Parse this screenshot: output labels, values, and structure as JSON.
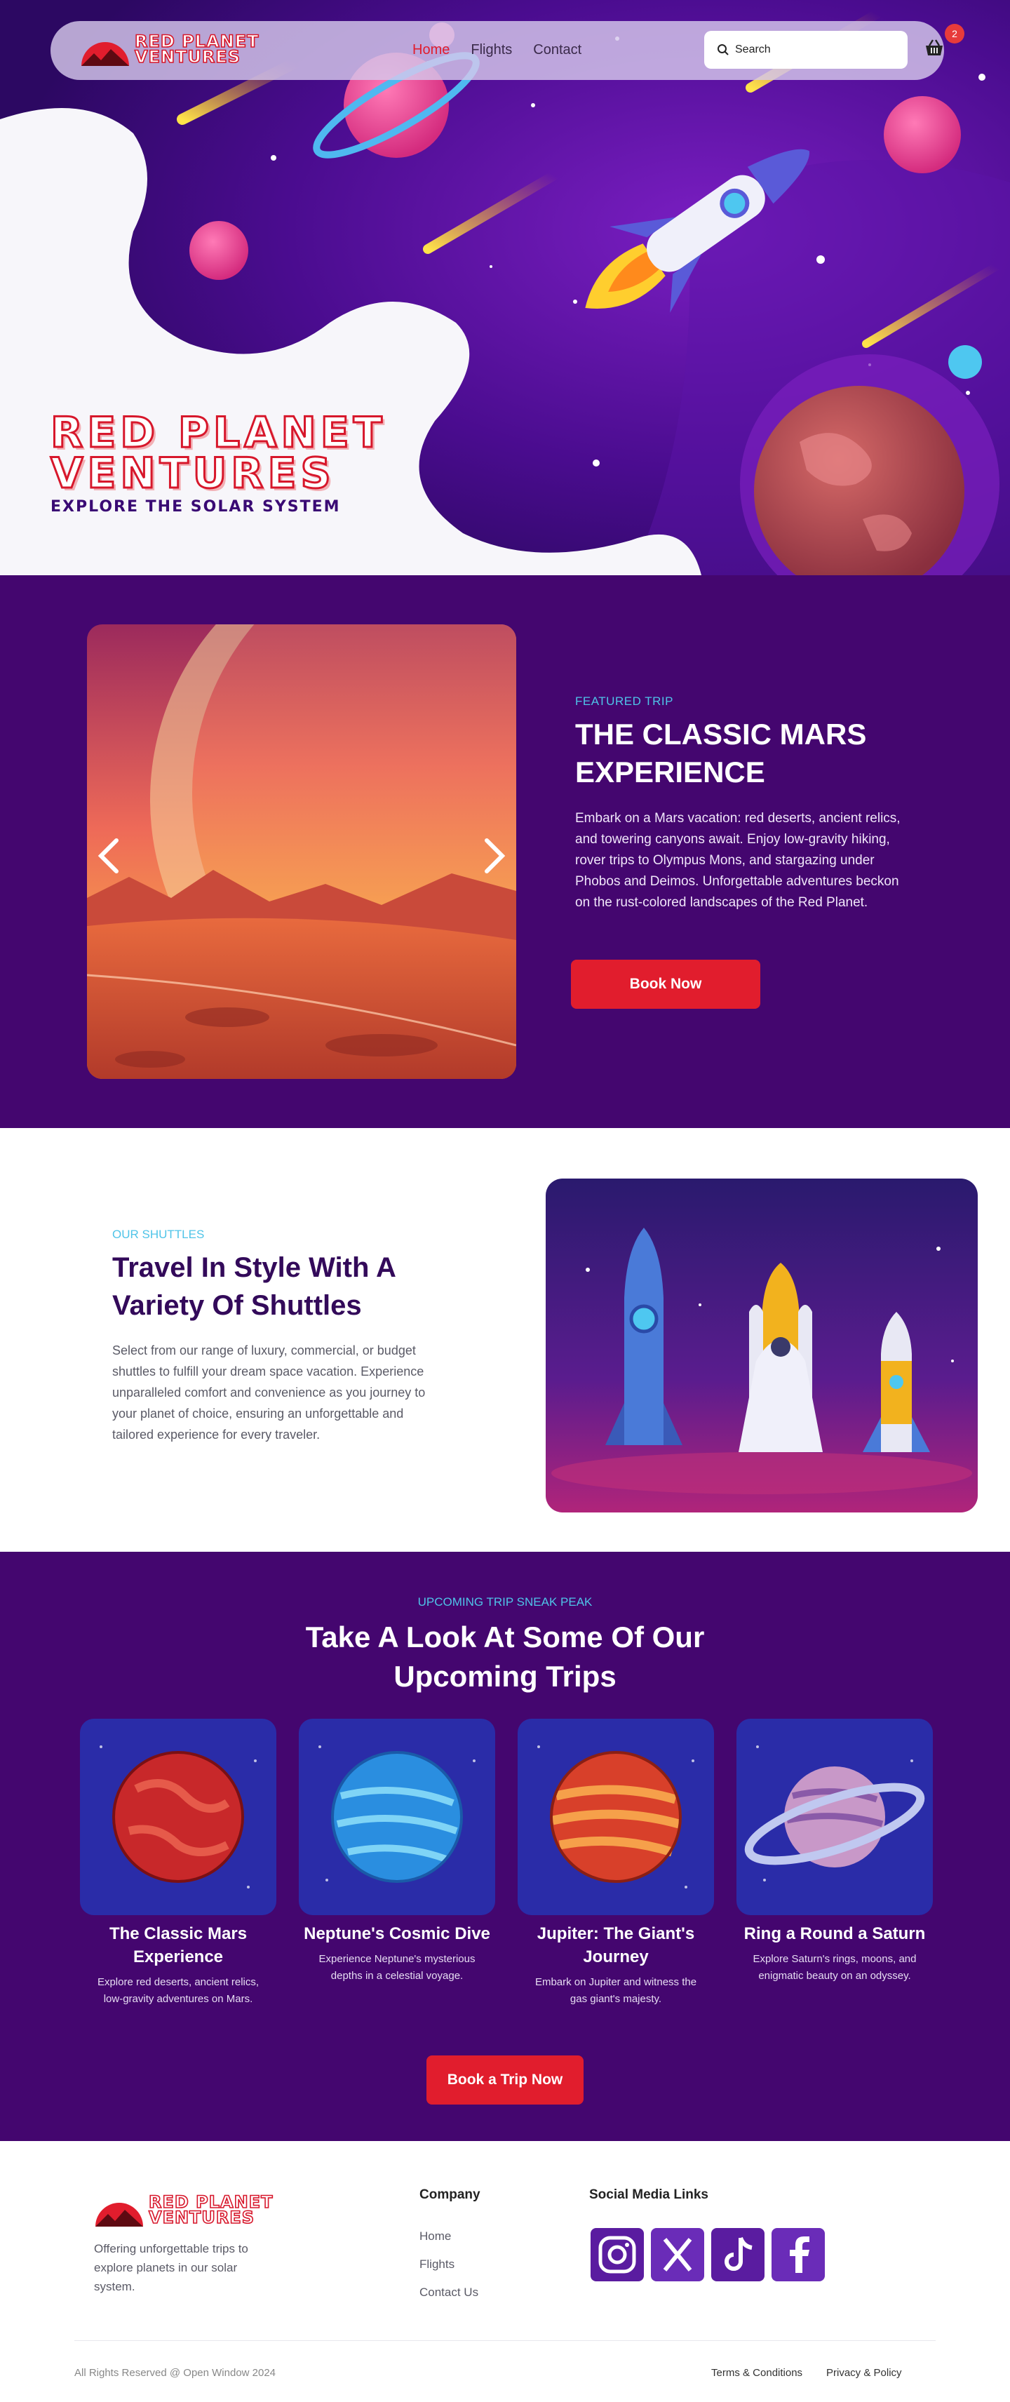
{
  "nav": {
    "brand_line1": "RED PLANET",
    "brand_line2": "VENTURES",
    "links": [
      "Home",
      "Flights",
      "Contact"
    ],
    "active": "Home",
    "search_placeholder": "Search",
    "cart_count": "2"
  },
  "hero": {
    "title_line1": "RED PLANET",
    "title_line2": "VENTURES",
    "subtitle": "EXPLORE THE SOLAR SYSTEM"
  },
  "featured": {
    "eyebrow": "FEATURED TRIP",
    "title": "THE CLASSIC MARS EXPERIENCE",
    "body": "Embark on a Mars vacation: red deserts, ancient relics, and towering canyons await. Enjoy low-gravity hiking, rover trips to Olympus Mons, and stargazing under Phobos and Deimos. Unforgettable adventures beckon on the rust-colored landscapes of the Red Planet.",
    "button": "Book Now"
  },
  "shuttles": {
    "eyebrow": "OUR SHUTTLES",
    "title": "Travel In Style With A Variety Of Shuttles",
    "body": "Select from our range of luxury, commercial, or budget shuttles to fulfill your dream space vacation. Experience unparalleled comfort and convenience as you journey to your planet of choice, ensuring an unforgettable and tailored experience for every traveler."
  },
  "trips": {
    "eyebrow": "UPCOMING TRIP SNEAK PEAK",
    "title": "Take A Look At Some Of Our Upcoming Trips",
    "cards": [
      {
        "title": "The Classic Mars Experience",
        "text": "Explore red deserts, ancient relics, low-gravity adventures on Mars."
      },
      {
        "title": "Neptune's Cosmic Dive",
        "text": "Experience Neptune's mysterious depths in a celestial voyage."
      },
      {
        "title": "Jupiter: The Giant's Journey",
        "text": "Embark on Jupiter and witness the gas giant's majesty."
      },
      {
        "title": "Ring a Round a Saturn",
        "text": "Explore Saturn's rings, moons, and enigmatic beauty on an odyssey."
      }
    ],
    "button": "Book a Trip Now"
  },
  "footer": {
    "brand_line1": "RED PLANET",
    "brand_line2": "VENTURES",
    "description": "Offering unforgettable trips to explore planets in our solar system.",
    "company_heading": "Company",
    "company_links": [
      "Home",
      "Flights",
      "Contact Us"
    ],
    "social_heading": "Social Media Links",
    "social_icons": [
      "instagram-icon",
      "x-icon",
      "tiktok-icon",
      "facebook-icon"
    ],
    "copyright": "All Rights Reserved @ Open Window 2024",
    "terms": "Terms & Conditions",
    "privacy": "Privacy & Policy"
  },
  "colors": {
    "brand_red": "#e11d2d",
    "purple": "#44066f",
    "accent_cyan": "#4fc4e8"
  }
}
